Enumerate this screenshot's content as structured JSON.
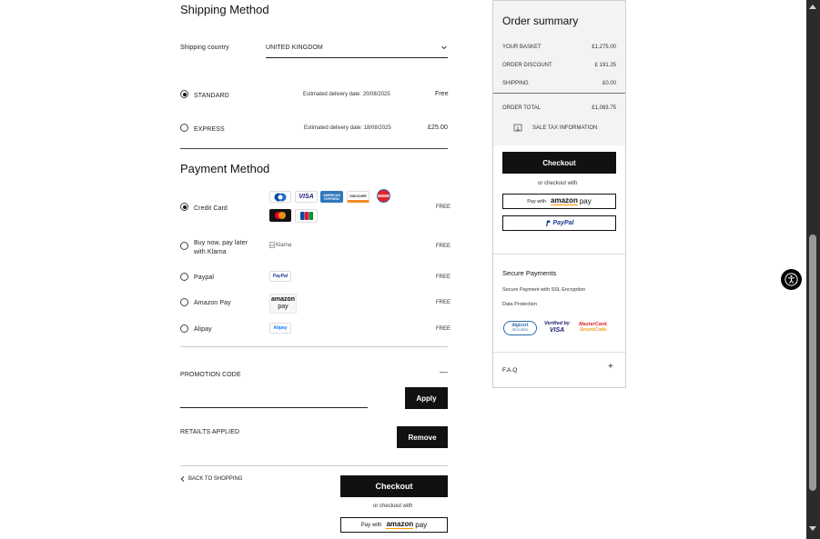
{
  "shipping": {
    "title": "Shipping Method",
    "country_label": "Shipping country",
    "country_value": "UNITED KINGDOM",
    "options": [
      {
        "label": "STANDARD",
        "estimate": "Estimated delivery date: 20/08/2025",
        "price": "Free",
        "selected": true
      },
      {
        "label": "EXPRESS",
        "estimate": "Estimated delivery date: 18/08/2025",
        "price": "£25.00",
        "selected": false
      }
    ]
  },
  "payment": {
    "title": "Payment Method",
    "methods": [
      {
        "label": "Credit Card",
        "price": "FREE",
        "selected": true
      },
      {
        "label": "Buy now, pay later with Klarna",
        "price": "FREE",
        "selected": false,
        "logo_alt": "Klarna"
      },
      {
        "label": "Paypal",
        "price": "FREE",
        "selected": false
      },
      {
        "label": "Amazon Pay",
        "price": "FREE",
        "selected": false
      },
      {
        "label": "Alipay",
        "price": "FREE",
        "selected": false
      }
    ],
    "card_logos": {
      "visa": "VISA",
      "amex": "AMERICAN EXPRESS",
      "discover": "DISCOVER",
      "paypal_badge": "PayPal",
      "amazon_badge_1": "amazon",
      "amazon_badge_2": "pay",
      "alipay_badge": "Alipay"
    }
  },
  "promotion": {
    "label": "PROMOTION CODE",
    "toggle": "—",
    "input_value": "",
    "apply_label": "Apply",
    "applied_text": "RETAILTS APPLIED",
    "remove_label": "Remove"
  },
  "bottom": {
    "back_label": "BACK TO SHOPPING",
    "checkout_label": "Checkout",
    "or_checkout_with": "or checkout with",
    "amazon_pay_with": "Pay with",
    "amazon_word": "amazon",
    "amazon_pay": "pay"
  },
  "summary": {
    "title": "Order summary",
    "rows": [
      {
        "label": "YOUR BASKET",
        "value": "£1,275.00"
      },
      {
        "label": "ORDER DISCOUNT",
        "value": "£ 191.25"
      },
      {
        "label": "SHIPPING",
        "value": "£0.00"
      }
    ],
    "total_label": "ORDER TOTAL",
    "total_value": "£1,083.75",
    "tax_info": "SALE TAX INFORMATION",
    "checkout_label": "Checkout",
    "or_checkout_with": "or checkout with",
    "amazon_pay_with": "Pay with",
    "amazon_word": "amazon",
    "amazon_pay": "pay",
    "paypal_label": "PayPal",
    "secure_title": "Secure Payments",
    "secure_line1": "Secure Payment with SSL Encryption",
    "secure_line2": "Data Protection",
    "badges": {
      "digicert_1": "digicert",
      "digicert_2": "SECURED",
      "visa_1": "Verified by",
      "visa_2": "VISA",
      "mc_1": "MasterCard.",
      "mc_2": "SecureCode."
    },
    "faq_label": "F.A.Q",
    "faq_toggle": "+"
  }
}
